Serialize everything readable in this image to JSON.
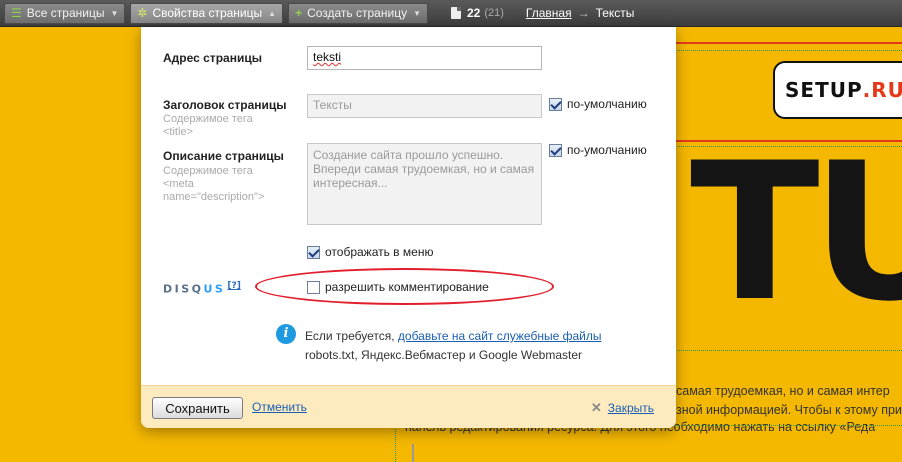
{
  "toolbar": {
    "all_pages": "Все страницы",
    "page_props": "Свойства страницы",
    "create_page": "Создать страницу",
    "page_count": "22",
    "page_count_sub": "(21)",
    "breadcrumb_home": "Главная",
    "breadcrumb_current": "Тексты"
  },
  "site": {
    "logo_text": "SETUP",
    "logo_suffix": ".RU",
    "big_letters": "TU",
    "line1": "самая трудоемкая, но и самая интер",
    "line2": "зной информацией. Чтобы к этому при",
    "line3": "панель редактирования ресурса. Для этого необходимо нажать на ссылку «Реда"
  },
  "form": {
    "address_label": "Адрес страницы",
    "address_value": "teksti",
    "title_label": "Заголовок страницы",
    "title_hint": "Содержимое тега <title>",
    "title_value": "Тексты",
    "title_default": "по-умолчанию",
    "desc_label": "Описание страницы",
    "desc_hint_1": "Содержимое тега",
    "desc_hint_2": "<meta",
    "desc_hint_3": "name=\"description\">",
    "desc_value": "Создание сайта прошло успешно. Впереди самая трудоемкая, но и самая интересная...",
    "desc_default": "по-умолчанию",
    "show_in_menu": "отображать в меню",
    "allow_comments": "разрешить комментирование",
    "disqus_brand_a": "DISQ",
    "disqus_brand_b": "US",
    "disqus_help": "[?]",
    "info_prefix": "Если требуется, ",
    "info_link": "добавьте на сайт служебные файлы",
    "info_line2": "robots.txt, Яндекс.Вебмастер и Google Webmaster"
  },
  "checkboxes": {
    "title_default": true,
    "desc_default": true,
    "show_in_menu": true,
    "allow_comments": false
  },
  "footer": {
    "save": "Сохранить",
    "cancel": "Отменить",
    "close": "Закрыть"
  },
  "icons": {
    "list": "list-icon",
    "gear": "gear-icon",
    "plus": "plus-icon",
    "document": "document-icon",
    "info": "info-icon",
    "close": "close-icon"
  },
  "colors": {
    "background": "#f5b800",
    "accent_red": "#e21e2c",
    "link": "#1a5fb4",
    "footer_bg": "#fdebbf"
  }
}
